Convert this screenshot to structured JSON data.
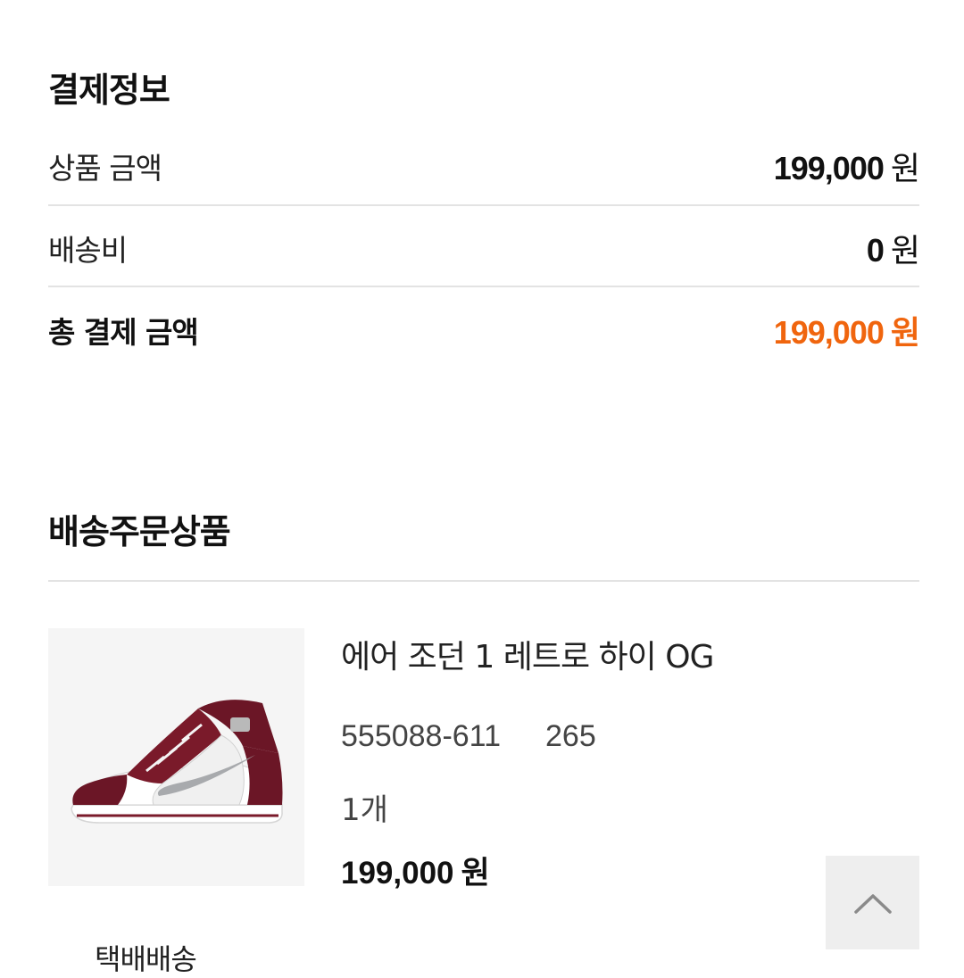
{
  "payment": {
    "title": "결제정보",
    "product_amount": {
      "label": "상품 금액",
      "amount": "199,000",
      "unit": "원"
    },
    "shipping_fee": {
      "label": "배송비",
      "amount": "0",
      "unit": "원"
    },
    "total": {
      "label": "총 결제 금액",
      "amount": "199,000",
      "unit": "원"
    }
  },
  "shipping_order": {
    "title": "배송주문상품",
    "product": {
      "image_icon": "sneaker-image",
      "name": "에어 조던 1 레트로 하이 OG",
      "code": "555088-611",
      "size": "265",
      "quantity": "1개",
      "price": "199,000",
      "price_unit": "원",
      "delivery_method": "택배배송"
    }
  },
  "scroll_top_icon": "chevron-up-icon",
  "colors": {
    "accent": "#f0650e",
    "divider": "#e3e3e3",
    "thumb_bg": "#f5f5f5",
    "scroll_btn_bg": "#eeeeee"
  }
}
